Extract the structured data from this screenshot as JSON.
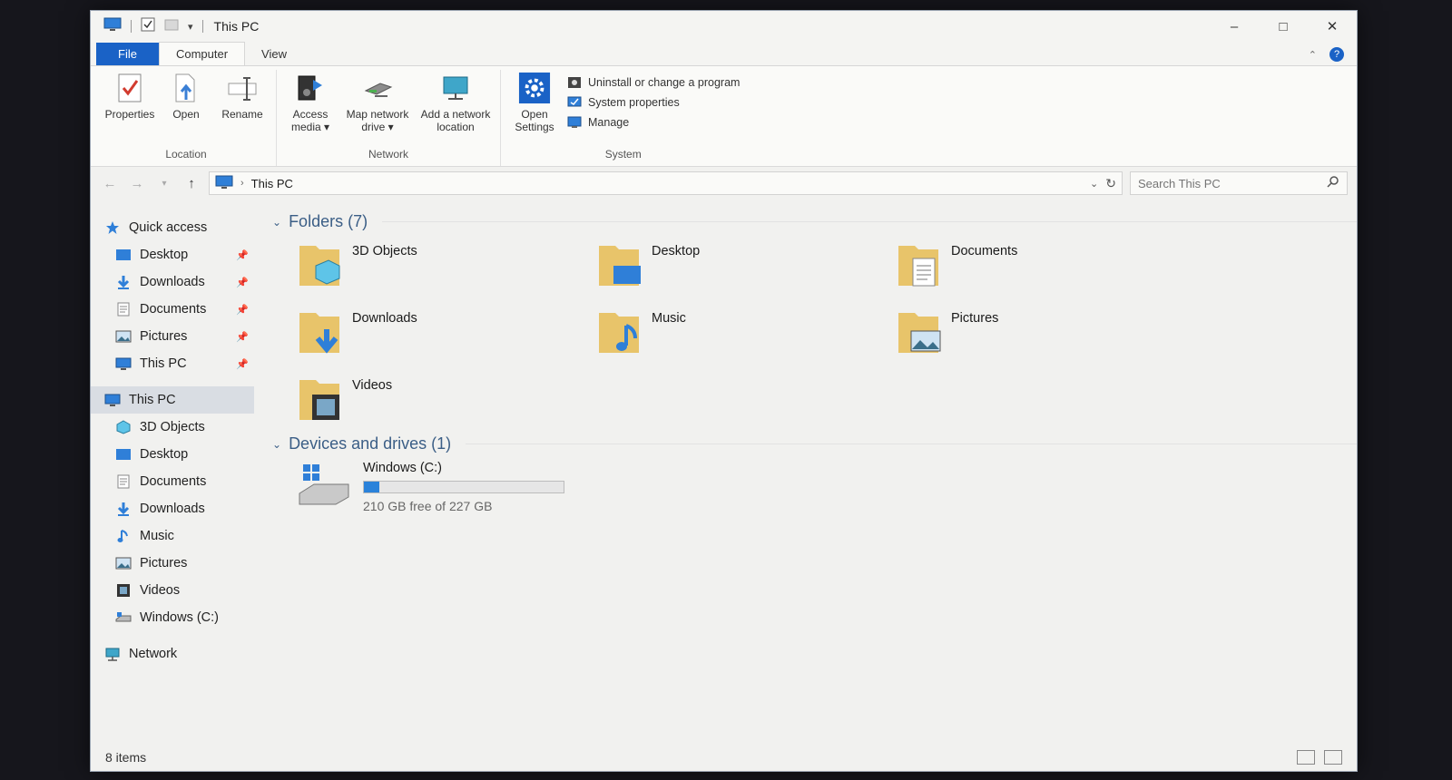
{
  "window": {
    "title": "This PC",
    "controls": {
      "minimize": "–",
      "maximize": "□",
      "close": "✕"
    }
  },
  "ribbon": {
    "tabs": [
      "File",
      "Computer",
      "View"
    ],
    "groups": {
      "location": {
        "label": "Location",
        "buttons": [
          {
            "label": "Properties",
            "icon": "properties-icon"
          },
          {
            "label": "Open",
            "icon": "open-icon"
          },
          {
            "label": "Rename",
            "icon": "rename-icon"
          }
        ]
      },
      "network": {
        "label": "Network",
        "buttons": [
          {
            "label": "Access media ▾",
            "icon": "access-media-icon"
          },
          {
            "label": "Map network drive ▾",
            "icon": "map-network-drive-icon"
          },
          {
            "label": "Add a network location",
            "icon": "add-network-location-icon"
          }
        ]
      },
      "system": {
        "label": "System",
        "open_settings": "Open Settings",
        "items": [
          {
            "label": "Uninstall or change a program",
            "icon": "uninstall-icon"
          },
          {
            "label": "System properties",
            "icon": "system-properties-icon"
          },
          {
            "label": "Manage",
            "icon": "manage-icon"
          }
        ]
      }
    }
  },
  "address": {
    "path": "This PC",
    "search_placeholder": "Search This PC"
  },
  "nav_pane": {
    "quick_access": {
      "label": "Quick access",
      "items": [
        "Desktop",
        "Downloads",
        "Documents",
        "Pictures",
        "This PC"
      ]
    },
    "this_pc": {
      "label": "This PC",
      "items": [
        "3D Objects",
        "Desktop",
        "Documents",
        "Downloads",
        "Music",
        "Pictures",
        "Videos",
        "Windows (C:)"
      ]
    },
    "network": "Network"
  },
  "folders": {
    "header": "Folders (7)",
    "items": [
      "3D Objects",
      "Desktop",
      "Documents",
      "Downloads",
      "Music",
      "Pictures",
      "Videos"
    ]
  },
  "drives": {
    "header": "Devices and drives (1)",
    "items": [
      {
        "name": "Windows (C:)",
        "free": "210 GB free of 227 GB",
        "used_fraction": 0.075
      }
    ]
  },
  "status": {
    "count": "8 items"
  },
  "colors": {
    "accent": "#1a62c6",
    "folder": "#e8c46a",
    "section": "#3b5e86",
    "drive_bar": "#2a82da"
  }
}
